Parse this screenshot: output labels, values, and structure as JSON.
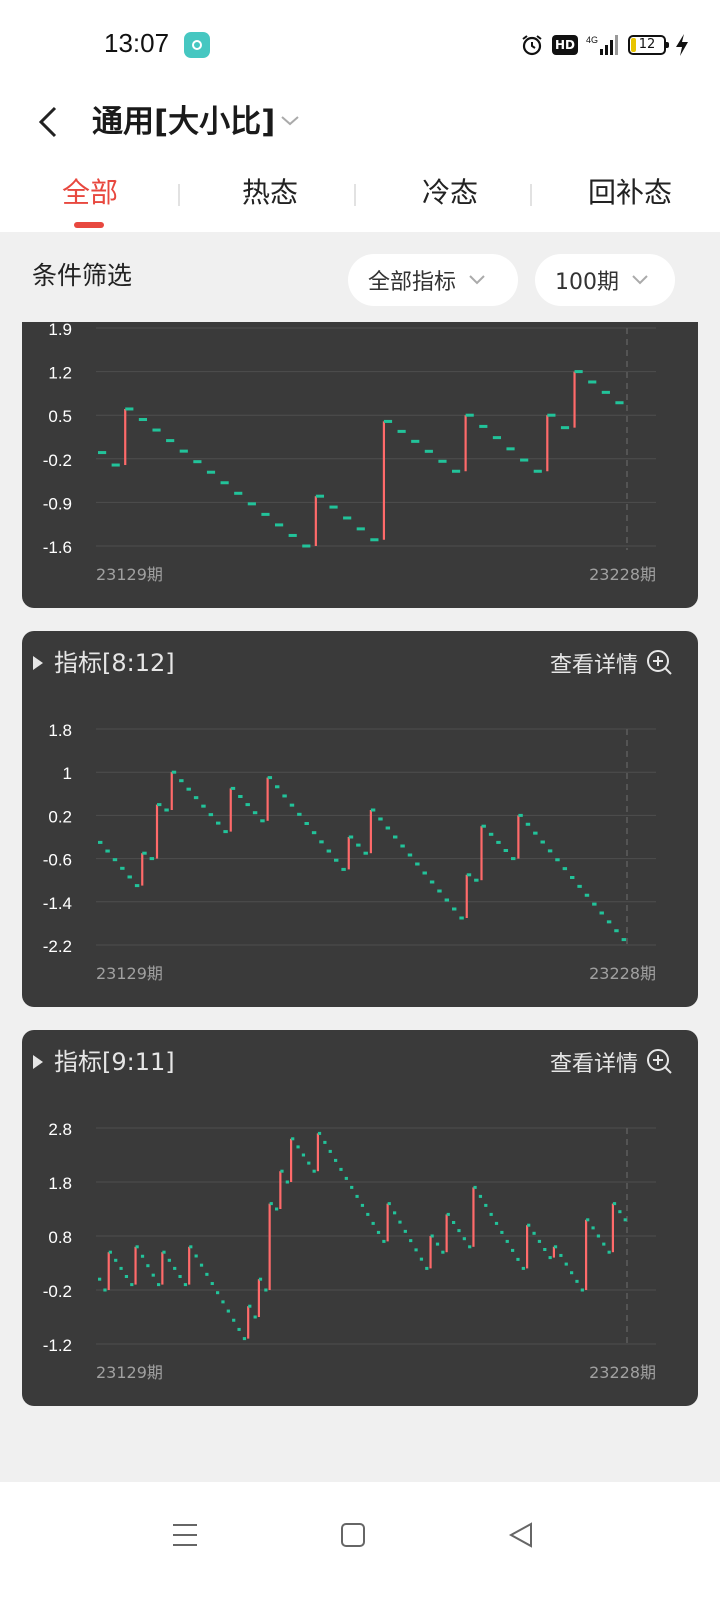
{
  "status_bar": {
    "time": "13:07",
    "network": "4G",
    "hd": "HD",
    "battery": "12"
  },
  "header": {
    "title": "通用[大小比]"
  },
  "tabs": [
    {
      "label": "全部",
      "active": true
    },
    {
      "label": "热态",
      "active": false
    },
    {
      "label": "冷态",
      "active": false
    },
    {
      "label": "回补态",
      "active": false
    }
  ],
  "filter": {
    "label": "条件筛选",
    "indicator_select": "全部指标",
    "period_select": "100期"
  },
  "colors": {
    "up": "#ff6a6a",
    "down": "#22c39a",
    "accent": "#e8483f",
    "card_bg": "#3a3a3a"
  },
  "cards": [
    {
      "title": "",
      "detail_label": "",
      "x_start": "23129期",
      "x_end": "23228期",
      "chart_data": {
        "type": "line",
        "ylim": [
          -1.6,
          1.9
        ],
        "yticks": [
          "1.9",
          "1.2",
          "0.5",
          "-0.2",
          "-0.9",
          "-1.6"
        ],
        "tick_values": [
          1.9,
          1.2,
          0.5,
          -0.2,
          -0.9,
          -1.6
        ],
        "x_count": 100,
        "segments": [
          {
            "from": -0.1,
            "to": -0.3
          },
          {
            "from": 0.6,
            "to": -1.6
          },
          {
            "from": -0.8,
            "to": -1.5
          },
          {
            "from": 0.4,
            "to": -0.4
          },
          {
            "from": 0.5,
            "to": -0.4
          },
          {
            "from": 0.5,
            "to": 0.3
          },
          {
            "from": 1.2,
            "to": 0.7
          }
        ]
      }
    },
    {
      "title": "指标[8:12]",
      "detail_label": "查看详情",
      "x_start": "23129期",
      "x_end": "23228期",
      "chart_data": {
        "type": "line",
        "ylim": [
          -2.2,
          1.8
        ],
        "yticks": [
          "1.8",
          "1",
          "0.2",
          "-0.6",
          "-1.4",
          "-2.2"
        ],
        "tick_values": [
          1.8,
          1.0,
          0.2,
          -0.6,
          -1.4,
          -2.2
        ],
        "x_count": 100,
        "segments": [
          {
            "from": -0.3,
            "to": -1.1
          },
          {
            "from": -0.5,
            "to": -0.6
          },
          {
            "from": 0.4,
            "to": 0.3
          },
          {
            "from": 1.0,
            "to": -0.1
          },
          {
            "from": 0.7,
            "to": 0.1
          },
          {
            "from": 0.9,
            "to": -0.8
          },
          {
            "from": -0.2,
            "to": -0.5
          },
          {
            "from": 0.3,
            "to": -1.7
          },
          {
            "from": -0.9,
            "to": -1.0
          },
          {
            "from": 0.0,
            "to": -0.6
          },
          {
            "from": 0.2,
            "to": -2.1
          }
        ]
      }
    },
    {
      "title": "指标[9:11]",
      "detail_label": "查看详情",
      "x_start": "23129期",
      "x_end": "23228期",
      "chart_data": {
        "type": "line",
        "ylim": [
          -1.2,
          2.8
        ],
        "yticks": [
          "2.8",
          "1.8",
          "0.8",
          "-0.2",
          "-1.2"
        ],
        "tick_values": [
          2.8,
          1.8,
          0.8,
          -0.2,
          -1.2
        ],
        "x_count": 100,
        "segments": [
          {
            "from": 0.0,
            "to": -0.2
          },
          {
            "from": 0.5,
            "to": -0.1
          },
          {
            "from": 0.6,
            "to": -0.1
          },
          {
            "from": 0.5,
            "to": -0.1
          },
          {
            "from": 0.6,
            "to": -1.1
          },
          {
            "from": -0.5,
            "to": -0.7
          },
          {
            "from": 0.0,
            "to": -0.2
          },
          {
            "from": 1.4,
            "to": 1.3
          },
          {
            "from": 2.0,
            "to": 1.8
          },
          {
            "from": 2.6,
            "to": 2.0
          },
          {
            "from": 2.7,
            "to": 0.7
          },
          {
            "from": 1.4,
            "to": 0.2
          },
          {
            "from": 0.8,
            "to": 0.5
          },
          {
            "from": 1.2,
            "to": 0.6
          },
          {
            "from": 1.7,
            "to": 0.2
          },
          {
            "from": 1.0,
            "to": 0.4
          },
          {
            "from": 0.6,
            "to": -0.2
          },
          {
            "from": 1.1,
            "to": 0.5
          },
          {
            "from": 1.4,
            "to": 1.1
          }
        ]
      }
    }
  ]
}
